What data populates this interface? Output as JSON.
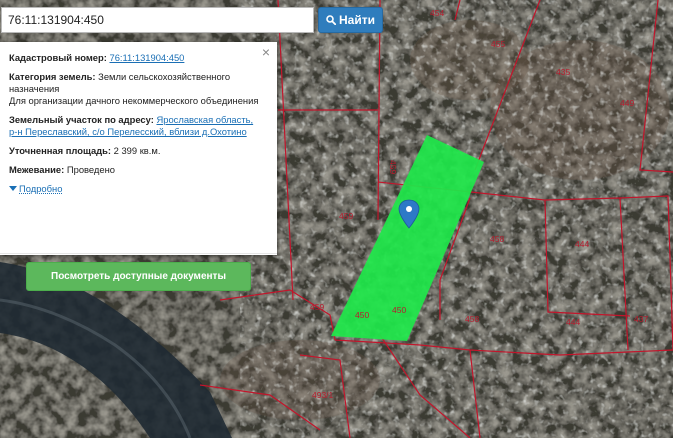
{
  "search": {
    "value": "76:11:131904:450",
    "button_label": "Найти",
    "icon": "search-icon"
  },
  "info_card": {
    "cadastral_label": "Кадастровый номер:",
    "cadastral_number": "76:11:131904:450",
    "category_label": "Категория земель:",
    "category_value": "Земли сельскохозяйственного назначения",
    "usage_value": "Для организации дачного некоммерческого объединения",
    "address_label": "Земельный участок по адресу:",
    "address_line1": "Ярославская область,",
    "address_line2": "р-н Переславский, с/о Перелесский, вблизи д.Охотино",
    "area_label": "Уточненная площадь:",
    "area_value": "2 399 кв.м.",
    "survey_label": "Межевание:",
    "survey_value": "Проведено",
    "more_label": "Подробно",
    "docs_button": "Посмотреть доступные документы",
    "close": "×"
  },
  "map": {
    "parcel_labels": [
      "454",
      "455",
      "435",
      "449",
      "459",
      "459",
      "458",
      "444",
      "459",
      "450",
      "450",
      "458",
      "444",
      "437",
      "493/1"
    ],
    "selected_fill": "#1ee84a",
    "boundary_color": "#c3152b"
  }
}
